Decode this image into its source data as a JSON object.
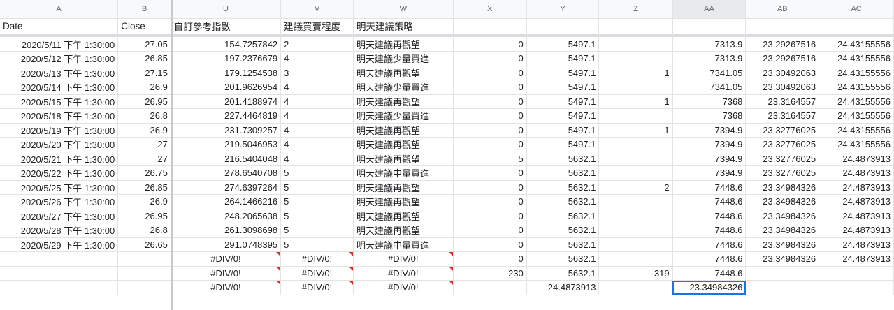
{
  "columns": [
    "A",
    "B",
    "U",
    "V",
    "W",
    "X",
    "Y",
    "Z",
    "AA",
    "AB",
    "AC"
  ],
  "header_row": [
    "Date",
    "Close",
    "自訂參考指數",
    "建議買賣程度",
    "明天建議策略",
    "",
    "",
    "",
    "",
    "",
    ""
  ],
  "rows": [
    [
      "2020/5/11 下午 1:30:00",
      "27.05",
      "154.7257842",
      "2",
      "明天建議再觀望",
      "0",
      "5497.1",
      "",
      "7313.9",
      "23.29267516",
      "24.43155556"
    ],
    [
      "2020/5/12 下午 1:30:00",
      "26.85",
      "197.2376679",
      "4",
      "明天建議少量買進",
      "0",
      "5497.1",
      "",
      "7313.9",
      "23.29267516",
      "24.43155556"
    ],
    [
      "2020/5/13 下午 1:30:00",
      "27.15",
      "179.1254538",
      "3",
      "明天建議再觀望",
      "0",
      "5497.1",
      "1",
      "7341.05",
      "23.30492063",
      "24.43155556"
    ],
    [
      "2020/5/14 下午 1:30:00",
      "26.9",
      "201.9626954",
      "4",
      "明天建議少量買進",
      "0",
      "5497.1",
      "",
      "7341.05",
      "23.30492063",
      "24.43155556"
    ],
    [
      "2020/5/15 下午 1:30:00",
      "26.95",
      "201.4188974",
      "4",
      "明天建議再觀望",
      "0",
      "5497.1",
      "1",
      "7368",
      "23.3164557",
      "24.43155556"
    ],
    [
      "2020/5/18 下午 1:30:00",
      "26.8",
      "227.4464819",
      "4",
      "明天建議少量買進",
      "0",
      "5497.1",
      "",
      "7368",
      "23.3164557",
      "24.43155556"
    ],
    [
      "2020/5/19 下午 1:30:00",
      "26.9",
      "231.7309257",
      "4",
      "明天建議再觀望",
      "0",
      "5497.1",
      "1",
      "7394.9",
      "23.32776025",
      "24.43155556"
    ],
    [
      "2020/5/20 下午 1:30:00",
      "27",
      "219.5046953",
      "4",
      "明天建議再觀望",
      "0",
      "5497.1",
      "",
      "7394.9",
      "23.32776025",
      "24.43155556"
    ],
    [
      "2020/5/21 下午 1:30:00",
      "27",
      "216.5404048",
      "4",
      "明天建議再觀望",
      "5",
      "5632.1",
      "",
      "7394.9",
      "23.32776025",
      "24.4873913"
    ],
    [
      "2020/5/22 下午 1:30:00",
      "26.75",
      "278.6540708",
      "5",
      "明天建議中量買進",
      "0",
      "5632.1",
      "",
      "7394.9",
      "23.32776025",
      "24.4873913"
    ],
    [
      "2020/5/25 下午 1:30:00",
      "26.85",
      "274.6397264",
      "5",
      "明天建議再觀望",
      "0",
      "5632.1",
      "2",
      "7448.6",
      "23.34984326",
      "24.4873913"
    ],
    [
      "2020/5/26 下午 1:30:00",
      "26.9",
      "264.1466216",
      "5",
      "明天建議再觀望",
      "0",
      "5632.1",
      "",
      "7448.6",
      "23.34984326",
      "24.4873913"
    ],
    [
      "2020/5/27 下午 1:30:00",
      "26.95",
      "248.2065638",
      "5",
      "明天建議再觀望",
      "0",
      "5632.1",
      "",
      "7448.6",
      "23.34984326",
      "24.4873913"
    ],
    [
      "2020/5/28 下午 1:30:00",
      "26.8",
      "261.3098698",
      "5",
      "明天建議再觀望",
      "0",
      "5632.1",
      "",
      "7448.6",
      "23.34984326",
      "24.4873913"
    ],
    [
      "2020/5/29 下午 1:30:00",
      "26.65",
      "291.0748395",
      "5",
      "明天建議中量買進",
      "0",
      "5632.1",
      "",
      "7448.6",
      "23.34984326",
      "24.4873913"
    ],
    [
      "",
      "",
      "#DIV/0!",
      "#DIV/0!",
      "#DIV/0!",
      "0",
      "5632.1",
      "",
      "7448.6",
      "23.34984326",
      "24.4873913"
    ],
    [
      "",
      "",
      "#DIV/0!",
      "#DIV/0!",
      "#DIV/0!",
      "230",
      "5632.1",
      "319",
      "7448.6",
      "",
      ""
    ],
    [
      "",
      "",
      "#DIV/0!",
      "#DIV/0!",
      "#DIV/0!",
      "",
      "24.4873913",
      "",
      "23.34984326",
      "",
      ""
    ]
  ],
  "selected_cell": "AA-last",
  "colors": {
    "header_bg": "#f8f9fa",
    "grid_line": "#e2e3e3",
    "selection": "#1a73e8",
    "error_flag": "#d93025"
  }
}
